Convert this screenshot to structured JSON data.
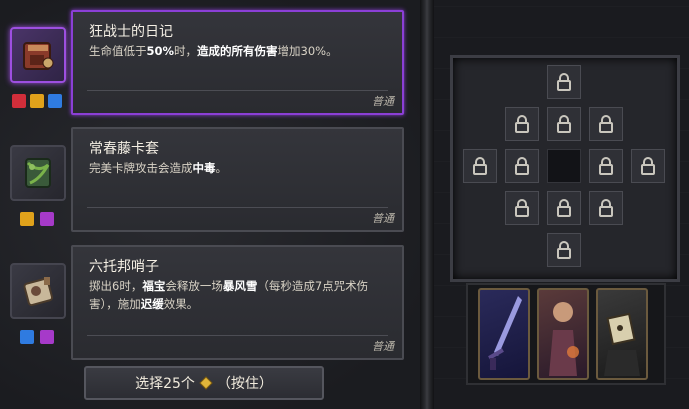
{
  "items": [
    {
      "title": "狂战士的日记",
      "desc_parts": [
        {
          "text": "生命值低于",
          "bold": false
        },
        {
          "text": "50%",
          "bold": true
        },
        {
          "text": "时，",
          "bold": false
        },
        {
          "text": "造成的所有伤害",
          "bold": true
        },
        {
          "text": "增加30%。",
          "bold": false
        }
      ],
      "rarity": "普通",
      "selected": true,
      "icon": "journal-icon",
      "tags": [
        {
          "icon": "sword-tag-icon",
          "color": "#d12e3a"
        },
        {
          "icon": "target-tag-icon",
          "color": "#e0a21b"
        },
        {
          "icon": "square-tag-icon",
          "color": "#2f7be0"
        }
      ]
    },
    {
      "title": "常春藤卡套",
      "desc_parts": [
        {
          "text": "完美卡牌攻击会造成",
          "bold": false
        },
        {
          "text": "中毒",
          "bold": true
        },
        {
          "text": "。",
          "bold": false
        }
      ],
      "rarity": "普通",
      "selected": false,
      "icon": "card-sleeve-icon",
      "tags": [
        {
          "icon": "target-tag-icon",
          "color": "#e0a21b"
        },
        {
          "icon": "spiral-tag-icon",
          "color": "#a63ac9"
        }
      ]
    },
    {
      "title": "六托邦哨子",
      "desc_parts": [
        {
          "text": "掷出6时，",
          "bold": false
        },
        {
          "text": "福宝",
          "bold": true
        },
        {
          "text": "会释放一场",
          "bold": false
        },
        {
          "text": "暴风雪",
          "bold": true
        },
        {
          "text": "（每秒造成7点咒术伤害），施加",
          "bold": false
        },
        {
          "text": "迟缓",
          "bold": true
        },
        {
          "text": "效果。",
          "bold": false
        }
      ],
      "rarity": "普通",
      "selected": false,
      "icon": "whistle-icon",
      "tags": [
        {
          "icon": "square-tag-icon",
          "color": "#2f7be0"
        },
        {
          "icon": "spiral-tag-icon",
          "color": "#a63ac9"
        }
      ]
    }
  ],
  "select_button": {
    "prefix": "选择25个",
    "suffix": "（按住）",
    "currency_icon": "gem-icon"
  },
  "grid": {
    "locked_icon": "lock-icon"
  },
  "bottom_cards": [
    "sword-card",
    "mage-card",
    "cube-card"
  ],
  "colors": {
    "accent_purple": "#9d4fe0",
    "gold": "#e0b53a"
  }
}
